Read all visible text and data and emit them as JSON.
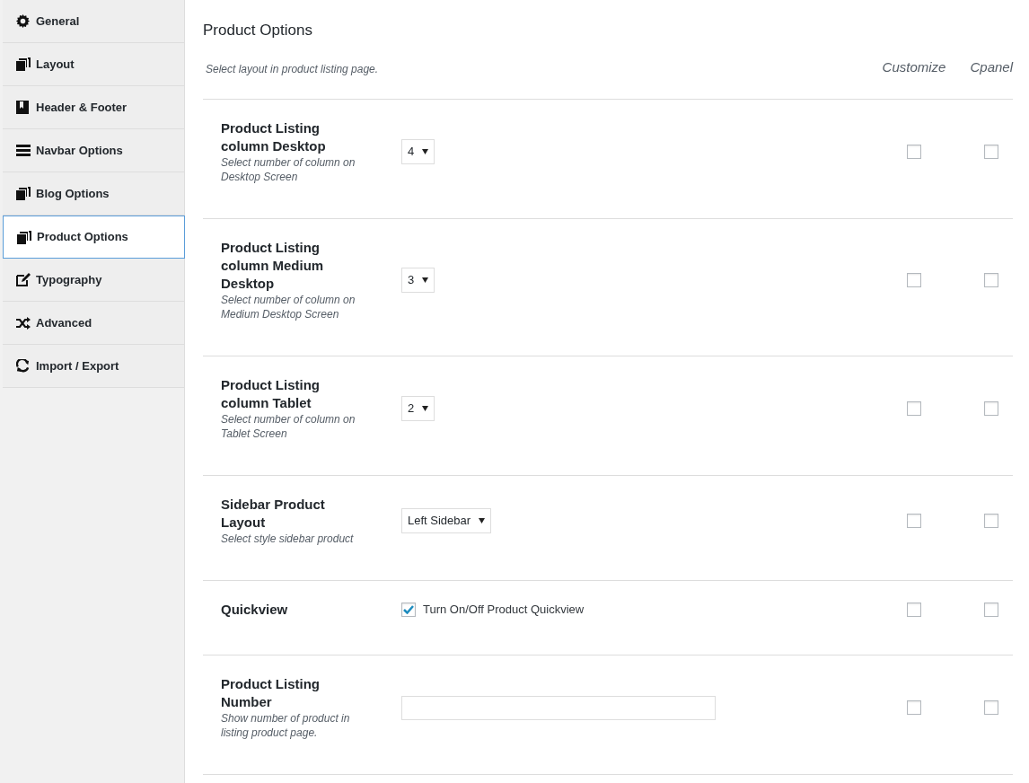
{
  "sidebar": {
    "items": [
      {
        "label": "General",
        "selected": false
      },
      {
        "label": "Layout",
        "selected": false
      },
      {
        "label": "Header & Footer",
        "selected": false
      },
      {
        "label": "Navbar Options",
        "selected": false
      },
      {
        "label": "Blog Options",
        "selected": false
      },
      {
        "label": "Product Options",
        "selected": true
      },
      {
        "label": "Typography",
        "selected": false
      },
      {
        "label": "Advanced",
        "selected": false
      },
      {
        "label": "Import / Export",
        "selected": false
      }
    ]
  },
  "panel": {
    "title": "Product Options",
    "description": "Select layout in product listing page.",
    "columns": [
      "Customize",
      "Cpanel"
    ],
    "options": [
      {
        "kind": "select",
        "title": "Product Listing column Desktop",
        "description": "Select number of column on Desktop Screen",
        "value": "4",
        "customize": false,
        "cpanel": false
      },
      {
        "kind": "select",
        "title": "Product Listing column Medium Desktop",
        "description": "Select number of column on Medium Desktop Screen",
        "value": "3",
        "customize": false,
        "cpanel": false
      },
      {
        "kind": "select",
        "title": "Product Listing column Tablet",
        "description": "Select number of column on Tablet Screen",
        "value": "2",
        "customize": false,
        "cpanel": false
      },
      {
        "kind": "select",
        "title": "Sidebar Product Layout",
        "description": "Select style sidebar product",
        "value": "Left Sidebar",
        "customize": false,
        "cpanel": false
      },
      {
        "kind": "checkbox",
        "title": "Quickview",
        "label": "Turn On/Off Product Quickview",
        "checked": true,
        "customize": false,
        "cpanel": false
      },
      {
        "kind": "text",
        "title": "Product Listing Number",
        "description": "Show number of product in listing product page.",
        "customize": false,
        "cpanel": false
      }
    ]
  }
}
